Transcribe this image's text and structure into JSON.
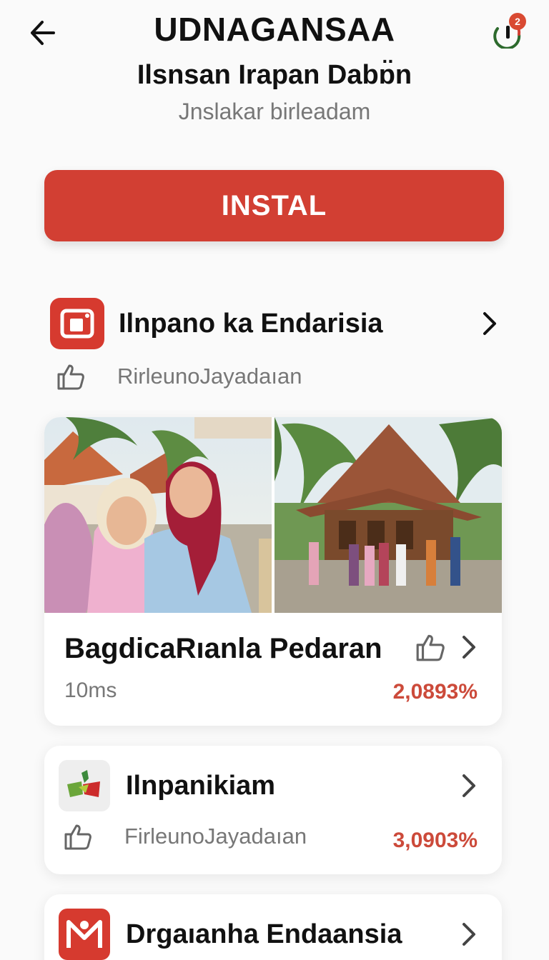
{
  "header": {
    "title": "UDNAGANSAA",
    "subtitle": "Ilsnsan Irapan Dabɒ̈n",
    "caption": "Jnslakar birleadam",
    "notification_count": "2"
  },
  "install": {
    "label": "INSTAL"
  },
  "section": {
    "title": "Ilnpano ka Endarisia",
    "subtitle": "RirleunoJayadaıan"
  },
  "featured_card": {
    "title": "BagdicaRıanla Pedaran",
    "meta": "10ms",
    "value": "2,0893%"
  },
  "items": [
    {
      "title": "Ilnpanikiam",
      "meta": "FirleunoJayadaıan",
      "value": "3,0903%"
    },
    {
      "title": "Drgaıanha Endaansia"
    }
  ],
  "colors": {
    "accent": "#d23f33",
    "value": "#cc4a3a",
    "muted": "#777777"
  }
}
